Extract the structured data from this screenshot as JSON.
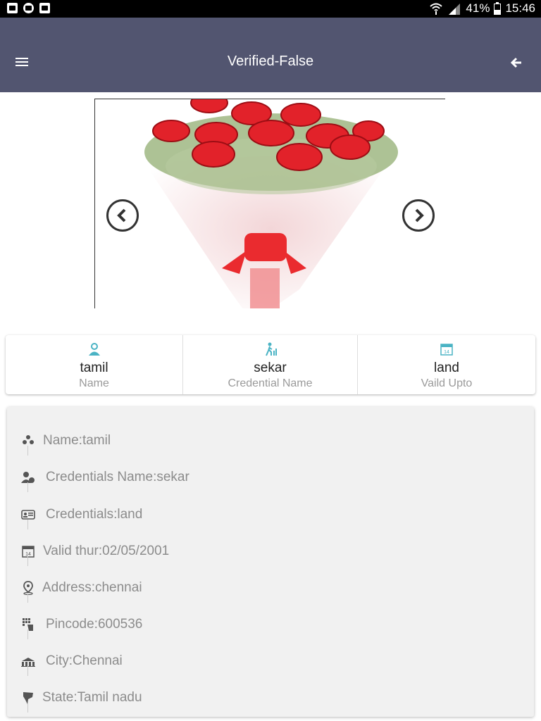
{
  "status_bar": {
    "battery_percent": "41%",
    "time": "15:46",
    "left_icons": [
      "gallery-icon",
      "camera-icon",
      "clipboard-check-icon"
    ],
    "right_icons": [
      "wifi-icon",
      "signal-icon",
      "battery-icon"
    ]
  },
  "app_bar": {
    "title": "Verified-False",
    "menu_icon": "menu-icon",
    "back_icon": "arrow-left-icon",
    "background": "#525570"
  },
  "carousel": {
    "prev_icon": "chevron-left-icon",
    "next_icon": "chevron-right-icon",
    "image": "red-rose-bouquet"
  },
  "summary": [
    {
      "icon": "user-icon",
      "value": "tamil",
      "label": "Name"
    },
    {
      "icon": "walking-person-icon",
      "value": "sekar",
      "label": "Credential Name"
    },
    {
      "icon": "calendar-icon",
      "value": "land",
      "label": "Vaild Upto"
    }
  ],
  "details": [
    {
      "icon": "people-icon",
      "text": "Name:tamil"
    },
    {
      "icon": "user-badge-icon",
      "text": "Credentials Name:sekar"
    },
    {
      "icon": "id-card-icon",
      "text": "Credentials:land"
    },
    {
      "icon": "calendar-icon",
      "text": "Valid thur:02/05/2001"
    },
    {
      "icon": "location-pin-icon",
      "text": "Address:chennai"
    },
    {
      "icon": "keypad-icon",
      "text": "Pincode:600536"
    },
    {
      "icon": "city-icon",
      "text": "City:Chennai"
    },
    {
      "icon": "map-icon",
      "text": "State:Tamil nadu"
    }
  ],
  "accent_color": "#4ab3c4"
}
